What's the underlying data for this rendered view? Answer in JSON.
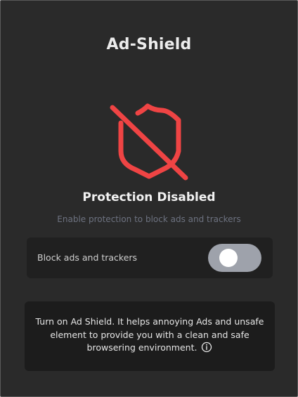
{
  "header": {
    "title": "Ad-Shield"
  },
  "status": {
    "icon": "shield-off-icon",
    "title": "Protection Disabled",
    "subtitle": "Enable protection to block ads and trackers",
    "icon_color": "#ef4444"
  },
  "toggle": {
    "label": "Block ads and trackers",
    "enabled": false,
    "track_color": "#9ea2ab"
  },
  "info": {
    "message": "Turn on Ad Shield. It helps annoying Ads and unsafe element to provide you with a clean and safe browsering environment.",
    "icon": "info-icon"
  }
}
